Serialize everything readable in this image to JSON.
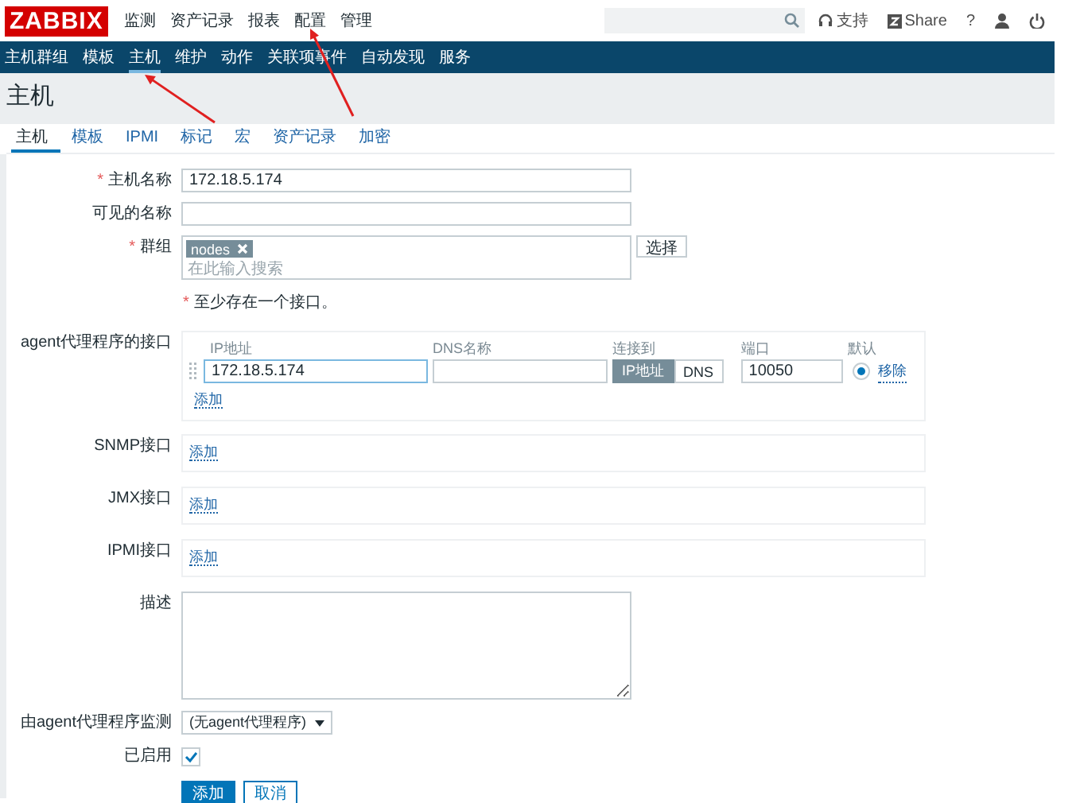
{
  "logo": "ZABBIX",
  "top_menu": [
    {
      "label": "监测"
    },
    {
      "label": "资产记录"
    },
    {
      "label": "报表"
    },
    {
      "label": "配置"
    },
    {
      "label": "管理"
    }
  ],
  "header_links": [
    {
      "kind": "support",
      "label": "支持"
    },
    {
      "kind": "share",
      "label": "Share"
    },
    {
      "kind": "help",
      "label": "?"
    }
  ],
  "nav": [
    {
      "label": "主机群组",
      "selected": false
    },
    {
      "label": "模板",
      "selected": false
    },
    {
      "label": "主机",
      "selected": true
    },
    {
      "label": "维护",
      "selected": false
    },
    {
      "label": "动作",
      "selected": false
    },
    {
      "label": "关联项事件",
      "selected": false
    },
    {
      "label": "自动发现",
      "selected": false
    },
    {
      "label": "服务",
      "selected": false
    }
  ],
  "page_title": "主机",
  "tabs": [
    {
      "label": "主机",
      "selected": true
    },
    {
      "label": "模板",
      "selected": false
    },
    {
      "label": "IPMI",
      "selected": false
    },
    {
      "label": "标记",
      "selected": false
    },
    {
      "label": "宏",
      "selected": false
    },
    {
      "label": "资产记录",
      "selected": false
    },
    {
      "label": "加密",
      "selected": false
    }
  ],
  "fields": [
    {
      "kind": "text",
      "label": "主机名称",
      "required_mark": "*",
      "value": "172.18.5.174"
    },
    {
      "kind": "text",
      "label": "可见的名称"
    },
    {
      "kind": "multiselect",
      "label": "群组",
      "required_mark": "*",
      "tags": [
        "nodes"
      ],
      "placeholder": "在此输入搜索",
      "button": "选择"
    },
    {
      "kind": "note",
      "required_mark": "*",
      "text": "至少存在一个接口。"
    },
    {
      "kind": "interface",
      "label": "agent代理程序的接口",
      "columns": [
        "IP地址",
        "DNS名称",
        "连接到",
        "端口",
        "默认"
      ],
      "rows": [
        {
          "ip": "172.18.5.174",
          "connect": [
            {
              "label": "IP地址",
              "selected": true
            },
            {
              "label": "DNS",
              "selected": false
            }
          ],
          "port": "10050",
          "default": true,
          "remove": "移除"
        }
      ],
      "add": "添加"
    },
    {
      "kind": "interface",
      "label": "SNMP接口",
      "add": "添加"
    },
    {
      "kind": "interface",
      "label": "JMX接口",
      "add": "添加"
    },
    {
      "kind": "interface",
      "label": "IPMI接口",
      "add": "添加"
    },
    {
      "kind": "textarea",
      "label": "描述"
    },
    {
      "kind": "select",
      "label": "由agent代理程序监测",
      "value": "(无agent代理程序)"
    },
    {
      "kind": "checkbox",
      "label": "已启用",
      "checked": true
    }
  ],
  "buttons": [
    {
      "kind": "primary",
      "label": "添加"
    },
    {
      "kind": "secondary",
      "label": "取消"
    }
  ]
}
